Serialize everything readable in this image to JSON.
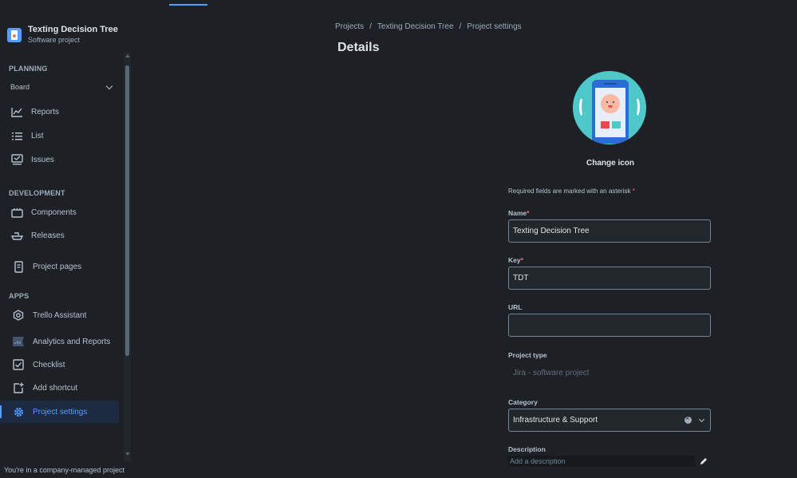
{
  "project": {
    "name": "Texting Decision Tree",
    "subtitle": "Software project"
  },
  "sidebar": {
    "planning_title": "PLANNING",
    "board_label": "Board",
    "planning_items": [
      {
        "label": "Reports",
        "icon": "chart-icon"
      },
      {
        "label": "List",
        "icon": "list-icon"
      },
      {
        "label": "Issues",
        "icon": "issues-icon"
      }
    ],
    "development_title": "DEVELOPMENT",
    "development_items": [
      {
        "label": "Components",
        "icon": "components-icon"
      },
      {
        "label": "Releases",
        "icon": "ship-icon"
      }
    ],
    "project_pages_label": "Project pages",
    "apps_title": "APPS",
    "apps_items": [
      {
        "label": "Trello Assistant",
        "icon": "trello-icon"
      },
      {
        "label": "Analytics and Reports",
        "icon": "analytics-icon"
      },
      {
        "label": "Checklist",
        "icon": "checklist-icon"
      },
      {
        "label": "Add shortcut",
        "icon": "add-shortcut-icon"
      },
      {
        "label": "Project settings",
        "icon": "gear-icon"
      }
    ],
    "footer_note": "You're in a company-managed project"
  },
  "breadcrumb": [
    "Projects",
    "Texting Decision Tree",
    "Project settings"
  ],
  "breadcrumb_sep": "/",
  "page_title": "Details",
  "change_icon_label": "Change icon",
  "required_note": "Required fields are marked with an asterisk",
  "asterisk": "*",
  "form": {
    "name_label": "Name",
    "name_value": "Texting Decision Tree",
    "key_label": "Key",
    "key_value": "TDT",
    "url_label": "URL",
    "url_value": "",
    "project_type_label": "Project type",
    "project_type_value": "Jira - software project",
    "category_label": "Category",
    "category_value": "Infrastructure & Support",
    "description_label": "Description",
    "description_placeholder": "Add a description"
  },
  "colors": {
    "accent": "#579dff",
    "background": "#1d2125",
    "required": "#f87168"
  }
}
